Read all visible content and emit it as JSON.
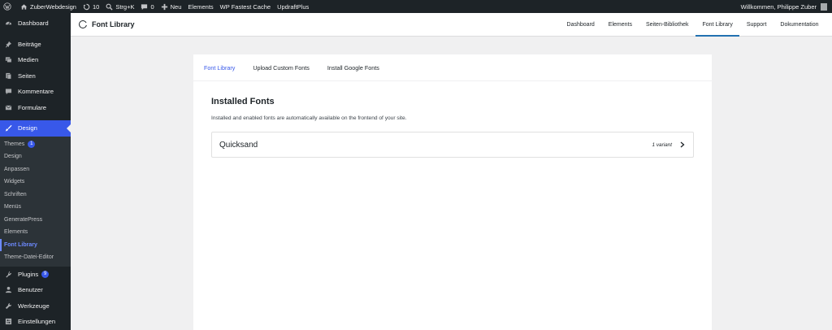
{
  "adminbar": {
    "site_name": "ZuberWebdesign",
    "updates_count": "10",
    "search_shortcut": "Strg+K",
    "comments_count": "0",
    "new_label": "Neu",
    "elements_label": "Elements",
    "fastest_cache_label": "WP Fastest Cache",
    "updraft_label": "UpdraftPlus",
    "greeting": "Willkommen, Philippe Zuber"
  },
  "sidebar": {
    "dashboard": "Dashboard",
    "beitraege": "Beiträge",
    "medien": "Medien",
    "seiten": "Seiten",
    "kommentare": "Kommentare",
    "formulare": "Formulare",
    "design": "Design",
    "design_sub": {
      "themes": "Themes",
      "themes_badge": "1",
      "design": "Design",
      "anpassen": "Anpassen",
      "widgets": "Widgets",
      "schriften": "Schriften",
      "menues": "Menüs",
      "generatepress": "GeneratePress",
      "elements": "Elements",
      "font_library": "Font Library",
      "theme_editor": "Theme-Datei-Editor"
    },
    "plugins": "Plugins",
    "plugins_badge": "9",
    "benutzer": "Benutzer",
    "werkzeuge": "Werkzeuge",
    "einstellungen": "Einstellungen"
  },
  "header": {
    "title": "Font Library",
    "nav": {
      "dashboard": "Dashboard",
      "elements": "Elements",
      "seiten_bibliothek": "Seiten-Bibliothek",
      "font_library": "Font Library",
      "support": "Support",
      "dokumentation": "Dokumentation"
    }
  },
  "card": {
    "tabs": {
      "font_library": "Font Library",
      "upload": "Upload Custom Fonts",
      "google": "Install Google Fonts"
    },
    "heading": "Installed Fonts",
    "description": "Installed and enabled fonts are automatically available on the frontend of your site.",
    "fonts": [
      {
        "name": "Quicksand",
        "variants": "1 variant"
      }
    ]
  },
  "colors": {
    "admin_dark": "#1d2327",
    "accent": "#3858e9",
    "background": "#f0f0f1"
  }
}
